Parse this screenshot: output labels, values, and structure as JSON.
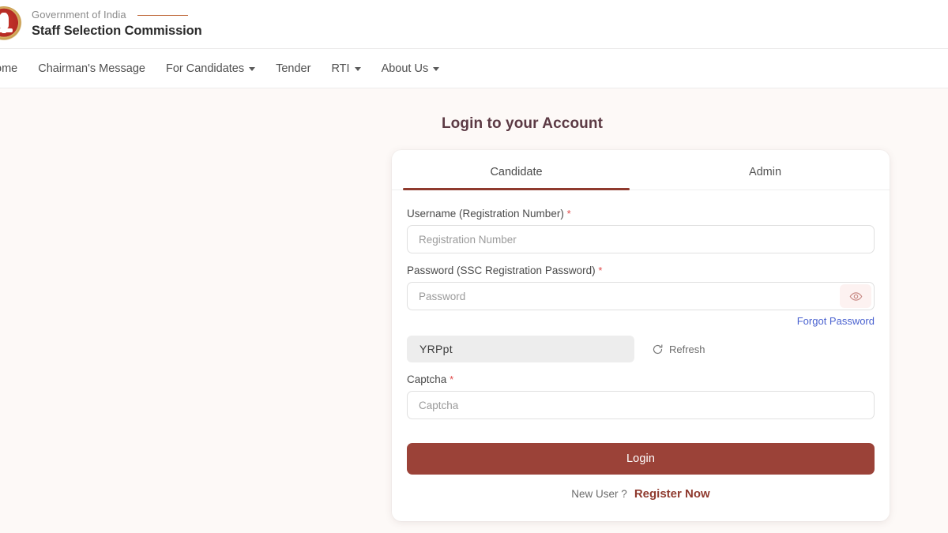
{
  "header": {
    "emblem_icon": "ssc-emblem-icon",
    "gov_line": "Government of India",
    "org_name": "Staff Selection Commission"
  },
  "nav": {
    "items": [
      {
        "label": "ome",
        "has_caret": false
      },
      {
        "label": "Chairman's Message",
        "has_caret": false
      },
      {
        "label": "For Candidates",
        "has_caret": true
      },
      {
        "label": "Tender",
        "has_caret": false
      },
      {
        "label": "RTI",
        "has_caret": true
      },
      {
        "label": "About Us",
        "has_caret": true
      }
    ]
  },
  "main": {
    "page_title": "Login to your Account"
  },
  "login_card": {
    "tabs": [
      {
        "label": "Candidate",
        "active": true
      },
      {
        "label": "Admin",
        "active": false
      }
    ],
    "username": {
      "label": "Username (Registration Number)",
      "required_mark": "*",
      "placeholder": "Registration Number",
      "value": ""
    },
    "password": {
      "label": "Password (SSC Registration Password)",
      "required_mark": "*",
      "placeholder": "Password",
      "value": "",
      "toggle_icon": "eye-icon"
    },
    "forgot_password": "Forgot Password",
    "captcha_image": {
      "text": "YRPpt",
      "refresh_label": "Refresh",
      "refresh_icon": "refresh-icon"
    },
    "captcha_input": {
      "label": "Captcha",
      "required_mark": "*",
      "placeholder": "Captcha",
      "value": ""
    },
    "login_button": "Login",
    "new_user_text": "New User ?",
    "register_link": "Register Now"
  },
  "colors": {
    "page_bg": "#fdf9f7",
    "brand_rule": "#c06a3c",
    "accent_maroon": "#8f3a2e",
    "login_button": "#9b4238",
    "link_blue": "#4a62d0",
    "required_red": "#e04b4b",
    "title": "#5c3a44",
    "captcha_bg": "#ededed"
  }
}
